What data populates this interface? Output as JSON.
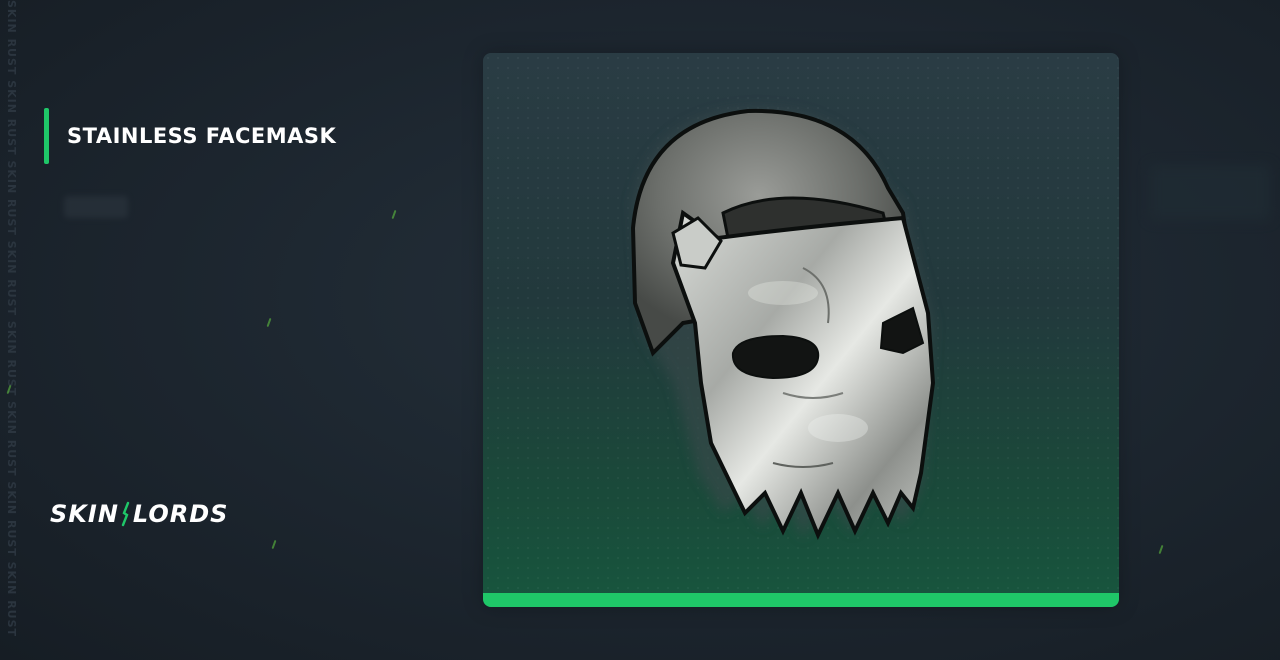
{
  "item": {
    "name": "STAINLESS FACEMASK"
  },
  "brand": {
    "logo_left": "SKIN",
    "logo_right": "LORDS",
    "side_watermark": "SKIN RUST SKIN RUST SKIN RUST SKIN RUST SKIN RUST SKIN RUST SKIN RUST SKIN RUST"
  },
  "colors": {
    "accent": "#1fc768",
    "background": "#1c252e",
    "card_top": "#2a3c44",
    "card_bottom": "#17563e"
  },
  "icons": {
    "item_image": "stainless-facemask-icon",
    "logo_mark": "skinlords-slash-icon"
  }
}
